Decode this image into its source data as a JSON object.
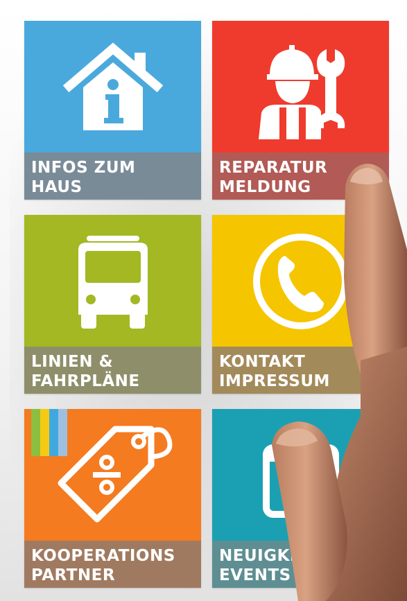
{
  "tiles": [
    {
      "line1": "INFOS ZUM",
      "line2": "HAUS",
      "icon": "house-info-icon",
      "color": "#4aa9dc",
      "bar": "#7a8b98"
    },
    {
      "line1": "REPARATUR",
      "line2": "MELDUNG",
      "icon": "repairman-wrench-icon",
      "color": "#ef3b2d",
      "bar": "#b25a55"
    },
    {
      "line1": "LINIEN &",
      "line2": "FAHRPLÄNE",
      "icon": "bus-icon",
      "color": "#a3b822",
      "bar": "#8e8f6a"
    },
    {
      "line1": "KONTAKT",
      "line2": "IMPRESSUM",
      "icon": "phone-circle-icon",
      "color": "#f5c500",
      "bar": "#a38a5a"
    },
    {
      "line1": "KOOPERATIONS",
      "line2": "PARTNER",
      "icon": "discount-tag-icon",
      "color": "#f47b20",
      "bar": "#a07a60"
    },
    {
      "line1": "NEUIGKE",
      "line2": "EVENTS",
      "icon": "calendar-icon",
      "color": "#1aa0b2",
      "bar": "#5e8e92"
    }
  ]
}
